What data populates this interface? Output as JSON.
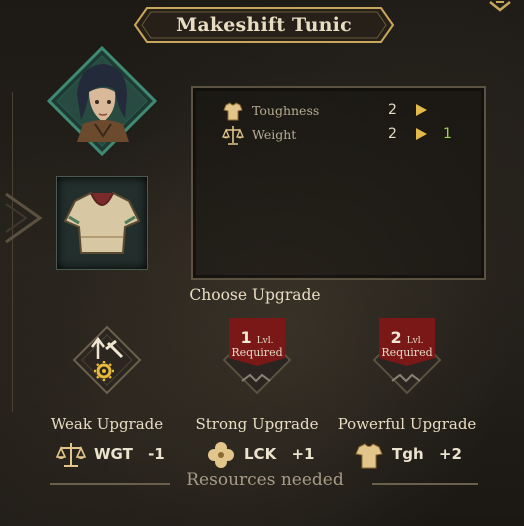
{
  "item": {
    "title": "Makeshift Tunic"
  },
  "stats": [
    {
      "label": "Toughness",
      "current": "2",
      "new": "",
      "icon": "tunic-icon"
    },
    {
      "label": "Weight",
      "current": "2",
      "new": "1",
      "icon": "scales-icon"
    }
  ],
  "upgrade": {
    "heading": "Choose Upgrade",
    "options": [
      {
        "name": "Weak Upgrade",
        "stat": "WGT",
        "delta": "-1",
        "icon": "hammer-gear-icon",
        "required_level": "",
        "required_label": ""
      },
      {
        "name": "Strong Upgrade",
        "stat": "LCK",
        "delta": "+1",
        "icon": "clover-icon",
        "required_level": "1",
        "level_abbr": "Lvl.",
        "required_label": "Required"
      },
      {
        "name": "Powerful Upgrade",
        "stat": "Tgh",
        "delta": "+2",
        "icon": "tunic-icon",
        "required_level": "2",
        "level_abbr": "Lvl.",
        "required_label": "Required"
      }
    ]
  },
  "resources": {
    "heading": "Resources needed"
  },
  "colors": {
    "accent_gold": "#c9a75a",
    "stat_increase_green": "#9bd24b",
    "required_red": "#7a1818",
    "portrait_frame_green": "#2f6a5a"
  }
}
